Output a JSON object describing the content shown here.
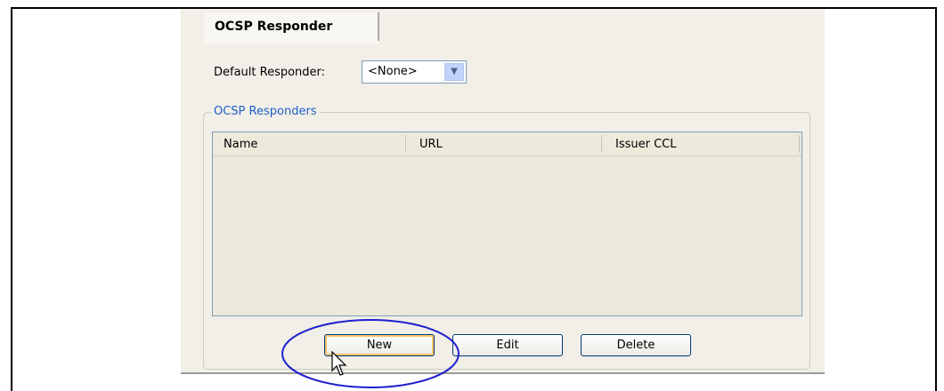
{
  "tab": {
    "label": "OCSP Responder"
  },
  "default_responder": {
    "label": "Default Responder:",
    "value": "<None>"
  },
  "group": {
    "title": "OCSP Responders"
  },
  "table": {
    "columns": [
      "Name",
      "URL",
      "Issuer CCL"
    ],
    "rows": []
  },
  "buttons": {
    "new": "New",
    "edit": "Edit",
    "delete": "Delete"
  },
  "colors": {
    "highlight": "#1f1fd0",
    "group_title": "#2060c8"
  }
}
